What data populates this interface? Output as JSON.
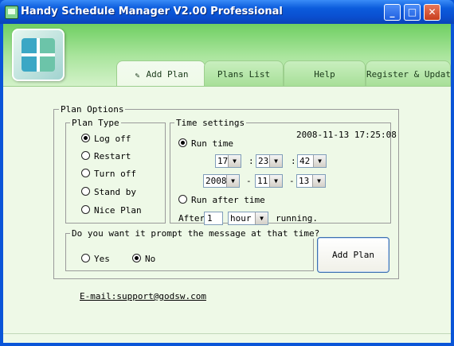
{
  "window": {
    "title": "Handy Schedule Manager V2.00 Professional"
  },
  "titlebar_buttons": {
    "minimize": "_",
    "maximize": "□",
    "close": "✕"
  },
  "tabs": [
    {
      "label": "Add Plan",
      "icon": "add-plan-icon"
    },
    {
      "label": "Plans List"
    },
    {
      "label": "Help"
    },
    {
      "label": "Register & Update"
    }
  ],
  "plan_options": {
    "legend": "Plan Options",
    "plan_type": {
      "legend": "Plan Type",
      "options": [
        "Log off",
        "Restart",
        "Turn off",
        "Stand by",
        "Nice Plan"
      ],
      "selected": "Log off"
    },
    "time_settings": {
      "legend": "Time settings",
      "current_datetime": "2008-11-13 17:25:08",
      "run_time_label": "Run time",
      "hour": "17",
      "minute": "23",
      "second": "42",
      "time_sep": ":",
      "year": "2008",
      "month": "11",
      "day": "13",
      "date_sep": "-",
      "run_after_label": "Run after time",
      "after_label": "After",
      "after_value": "1",
      "after_unit": "hour",
      "running_label": "running.",
      "selected": "Run time"
    },
    "prompt": {
      "legend": "Do you want it prompt the message at that time?",
      "yes_label": "Yes",
      "no_label": "No",
      "selected": "No"
    },
    "add_plan_button": "Add Plan"
  },
  "email": "E-mail:support@godsw.com",
  "colors": {
    "titlebar": "#0b5bdc",
    "client_bg": "#eef9e7",
    "banner": "#6fcf62"
  }
}
